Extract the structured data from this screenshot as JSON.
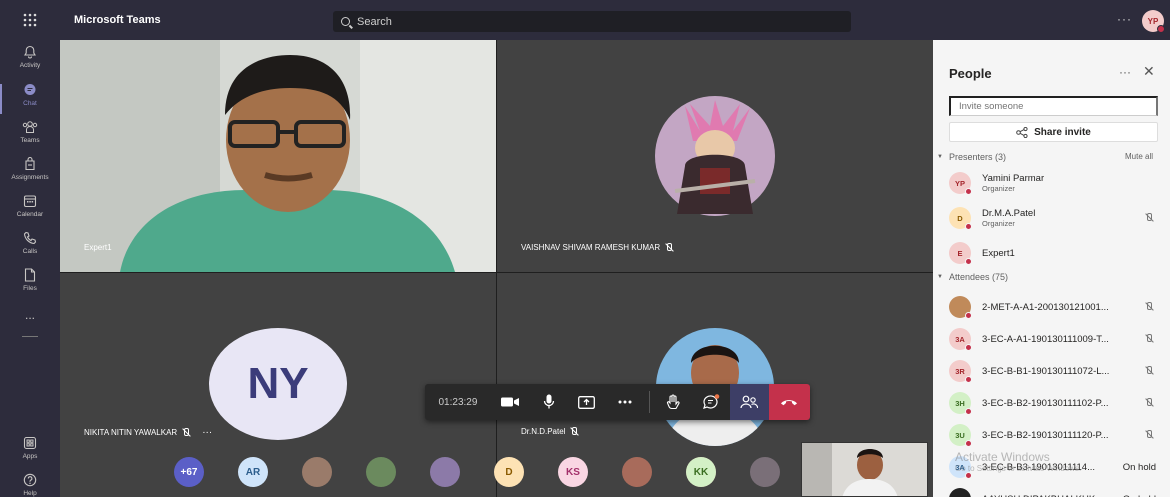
{
  "app": {
    "title": "Microsoft Teams",
    "user_initials": "YP"
  },
  "search": {
    "placeholder": "Search"
  },
  "rail": [
    {
      "label": "Activity",
      "icon": "bell-icon"
    },
    {
      "label": "Chat",
      "icon": "chat-icon",
      "active": true
    },
    {
      "label": "Teams",
      "icon": "teams-icon"
    },
    {
      "label": "Assignments",
      "icon": "assignments-icon"
    },
    {
      "label": "Calendar",
      "icon": "calendar-icon"
    },
    {
      "label": "Calls",
      "icon": "phone-icon"
    },
    {
      "label": "Files",
      "icon": "file-icon"
    },
    {
      "label": "...",
      "icon": "more-icon"
    },
    {
      "label": "Apps",
      "icon": "apps-icon"
    },
    {
      "label": "Help",
      "icon": "help-icon"
    }
  ],
  "tiles": {
    "t1": {
      "name": "Expert1"
    },
    "t2": {
      "name": "VAISHNAV SHIVAM RAMESH KUMAR"
    },
    "t3": {
      "name": "NIKITA NITIN YAWALKAR",
      "initials": "NY"
    },
    "t4": {
      "name": "Dr.N.D.Patel"
    }
  },
  "controls": {
    "timer": "01:23:29"
  },
  "strip": [
    {
      "label": "+67",
      "bg": "#5b5fc7",
      "fg": "#ffffff"
    },
    {
      "label": "AR",
      "bg": "#cfe4fa",
      "fg": "#2b5d8c"
    },
    {
      "label": "",
      "bg": "#9a7b6a",
      "fg": "#ffffff"
    },
    {
      "label": "",
      "bg": "#6b8a5e",
      "fg": "#ffffff"
    },
    {
      "label": "",
      "bg": "#8c7aa8",
      "fg": "#ffffff"
    },
    {
      "label": "D",
      "bg": "#fde2b4",
      "fg": "#8a5a00"
    },
    {
      "label": "KS",
      "bg": "#f9d6e3",
      "fg": "#a3306b"
    },
    {
      "label": "",
      "bg": "#a86b5b",
      "fg": "#ffffff"
    },
    {
      "label": "",
      "bg": "#b36a70",
      "fg": "#ffffff"
    },
    {
      "label": "KK",
      "bg": "#d3f0c6",
      "fg": "#3b6e22"
    },
    {
      "label": "",
      "bg": "#7a6f78",
      "fg": "#ffffff"
    }
  ],
  "panel": {
    "title": "People",
    "invite_placeholder": "Invite someone",
    "share_label": "Share invite",
    "presenters_label": "Presenters (3)",
    "mute_all": "Mute all",
    "attendees_label": "Attendees (75)",
    "presenters": [
      {
        "initials": "YP",
        "name": "Yamini Parmar",
        "role": "Organizer",
        "bg": "#f3cccb",
        "fg": "#a4262c",
        "muted": false
      },
      {
        "initials": "D",
        "name": "Dr.M.A.Patel",
        "role": "Organizer",
        "bg": "#fde2b4",
        "fg": "#8a5a00",
        "muted": true
      },
      {
        "initials": "E",
        "name": "Expert1",
        "role": "",
        "bg": "#f3cccb",
        "fg": "#a4262c",
        "muted": false
      }
    ],
    "attendees": [
      {
        "initials": "",
        "name": "2-MET-A-A1-200130121001...",
        "bg": "#c08a5a",
        "fg": "#ffffff",
        "status": ""
      },
      {
        "initials": "3A",
        "name": "3-EC-A-A1-190130111009-T...",
        "bg": "#f3cccb",
        "fg": "#a4262c",
        "status": ""
      },
      {
        "initials": "3R",
        "name": "3-EC-B-B1-190130111072-L...",
        "bg": "#f3cccb",
        "fg": "#a4262c",
        "status": ""
      },
      {
        "initials": "3H",
        "name": "3-EC-B-B2-190130111102-P...",
        "bg": "#d3f0c6",
        "fg": "#3b6e22",
        "status": ""
      },
      {
        "initials": "3U",
        "name": "3-EC-B-B2-190130111120-P...",
        "bg": "#d3f0c6",
        "fg": "#3b6e22",
        "status": ""
      },
      {
        "initials": "3A",
        "name": "3-EC-B-B3-19013011114...",
        "bg": "#cfe4fa",
        "fg": "#2b5d8c",
        "status": "On hold"
      },
      {
        "initials": "",
        "name": "AAYUSH DIPAKBHAI KUK...",
        "bg": "#222222",
        "fg": "#ffffff",
        "status": "On hold"
      }
    ]
  },
  "watermark": {
    "line1": "Activate Windows",
    "line2": "Go to Settings to activate Windows."
  }
}
